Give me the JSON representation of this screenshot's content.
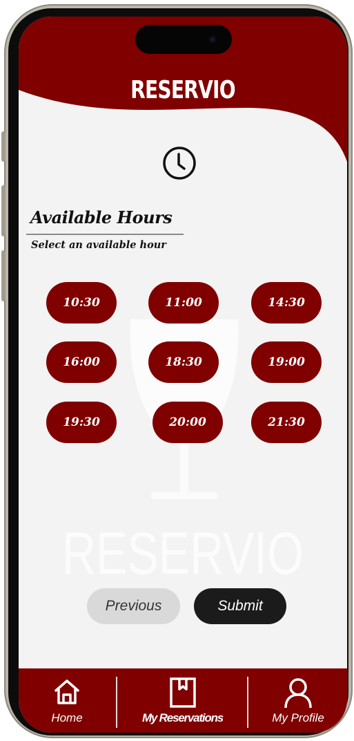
{
  "app": {
    "title": "RESERVIO"
  },
  "watermark": {
    "text": "RESERVIO"
  },
  "section": {
    "title": "Available Hours",
    "subtitle": "Select an available hour"
  },
  "hours": [
    "10:30",
    "11:00",
    "14:30",
    "16:00",
    "18:30",
    "19:00",
    "19:30",
    "20:00",
    "21:30"
  ],
  "actions": {
    "previous_label": "Previous",
    "submit_label": "Submit"
  },
  "tabbar": {
    "items": [
      {
        "label": "Home",
        "icon": "home-icon"
      },
      {
        "label": "My Reservations",
        "icon": "bookmark-icon"
      },
      {
        "label": "My Profile",
        "icon": "user-icon"
      }
    ]
  },
  "colors": {
    "brand": "#800000",
    "background": "#f3f3f3",
    "submit": "#1b1b1b",
    "previous": "#d9d9d9"
  }
}
